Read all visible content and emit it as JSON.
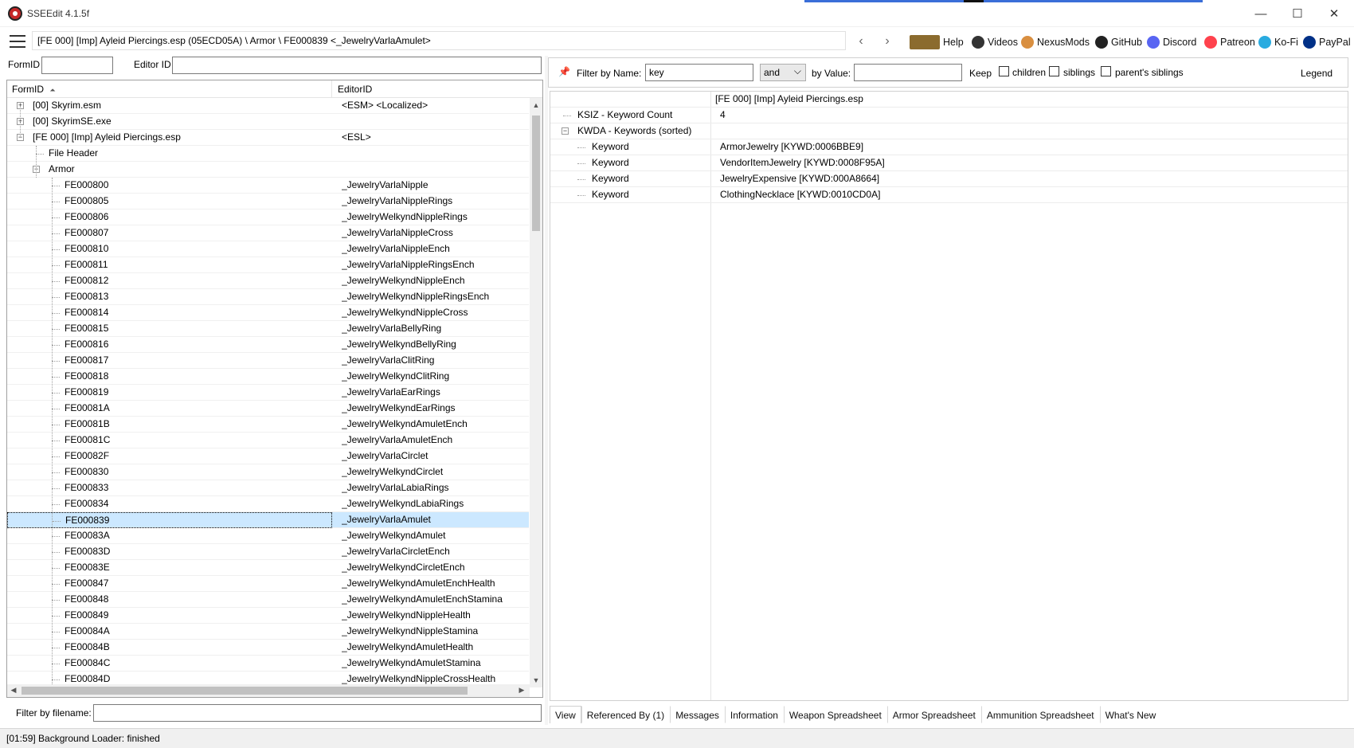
{
  "window": {
    "title": "SSEEdit 4.1.5f"
  },
  "toolbar": {
    "path": "[FE 000] [Imp] Ayleid Piercings.esp (05ECD05A) \\ Armor \\ FE000839 <_JewelryVarlaAmulet>",
    "back_glyph": "‹",
    "forward_glyph": "›",
    "links": [
      {
        "name": "help",
        "label": "Help",
        "icon": "book-icon",
        "color": "#8b6b2e"
      },
      {
        "name": "videos",
        "label": "Videos",
        "icon": "videos-icon",
        "color": "#333333"
      },
      {
        "name": "nexusmods",
        "label": "NexusMods",
        "icon": "nexusmods-icon",
        "color": "#d98f40"
      },
      {
        "name": "github",
        "label": "GitHub",
        "icon": "github-icon",
        "color": "#222222"
      },
      {
        "name": "discord",
        "label": "Discord",
        "icon": "discord-icon",
        "color": "#5865f2"
      },
      {
        "name": "patreon",
        "label": "Patreon",
        "icon": "patreon-icon",
        "color": "#ff424d"
      },
      {
        "name": "kofi",
        "label": "Ko-Fi",
        "icon": "kofi-icon",
        "color": "#29abe0"
      },
      {
        "name": "paypal",
        "label": "PayPal",
        "icon": "paypal-icon",
        "color": "#003087"
      }
    ]
  },
  "left": {
    "formid_label": "FormID",
    "editorid_label": "Editor ID",
    "formid_value": "",
    "editorid_value": "",
    "columns": {
      "formid": "FormID",
      "editorid": "EditorID"
    },
    "sort_glyph": "⏶",
    "filter_label": "Filter by filename:",
    "filter_value": "",
    "tree": [
      {
        "level": 0,
        "exp": "+",
        "formid": "[00] Skyrim.esm",
        "editorid": "<ESM> <Localized>"
      },
      {
        "level": 0,
        "exp": "+",
        "formid": "[00] SkyrimSE.exe",
        "editorid": ""
      },
      {
        "level": 0,
        "exp": "−",
        "formid": "[FE 000] [Imp] Ayleid Piercings.esp",
        "editorid": "<ESL>"
      },
      {
        "level": 1,
        "exp": "",
        "formid": "File Header",
        "editorid": ""
      },
      {
        "level": 1,
        "exp": "−",
        "formid": "Armor",
        "editorid": ""
      },
      {
        "level": 2,
        "exp": "",
        "formid": "FE000800",
        "editorid": "_JewelryVarlaNipple"
      },
      {
        "level": 2,
        "exp": "",
        "formid": "FE000805",
        "editorid": "_JewelryVarlaNippleRings"
      },
      {
        "level": 2,
        "exp": "",
        "formid": "FE000806",
        "editorid": "_JewelryWelkyndNippleRings"
      },
      {
        "level": 2,
        "exp": "",
        "formid": "FE000807",
        "editorid": "_JewelryVarlaNippleCross"
      },
      {
        "level": 2,
        "exp": "",
        "formid": "FE000810",
        "editorid": "_JewelryVarlaNippleEnch"
      },
      {
        "level": 2,
        "exp": "",
        "formid": "FE000811",
        "editorid": "_JewelryVarlaNippleRingsEnch"
      },
      {
        "level": 2,
        "exp": "",
        "formid": "FE000812",
        "editorid": "_JewelryWelkyndNippleEnch"
      },
      {
        "level": 2,
        "exp": "",
        "formid": "FE000813",
        "editorid": "_JewelryWelkyndNippleRingsEnch"
      },
      {
        "level": 2,
        "exp": "",
        "formid": "FE000814",
        "editorid": "_JewelryWelkyndNippleCross"
      },
      {
        "level": 2,
        "exp": "",
        "formid": "FE000815",
        "editorid": "_JewelryVarlaBellyRing"
      },
      {
        "level": 2,
        "exp": "",
        "formid": "FE000816",
        "editorid": "_JewelryWelkyndBellyRing"
      },
      {
        "level": 2,
        "exp": "",
        "formid": "FE000817",
        "editorid": "_JewelryVarlaClitRing"
      },
      {
        "level": 2,
        "exp": "",
        "formid": "FE000818",
        "editorid": "_JewelryWelkyndClitRing"
      },
      {
        "level": 2,
        "exp": "",
        "formid": "FE000819",
        "editorid": "_JewelryVarlaEarRings"
      },
      {
        "level": 2,
        "exp": "",
        "formid": "FE00081A",
        "editorid": "_JewelryWelkyndEarRings"
      },
      {
        "level": 2,
        "exp": "",
        "formid": "FE00081B",
        "editorid": "_JewelryWelkyndAmuletEnch"
      },
      {
        "level": 2,
        "exp": "",
        "formid": "FE00081C",
        "editorid": "_JewelryVarlaAmuletEnch"
      },
      {
        "level": 2,
        "exp": "",
        "formid": "FE00082F",
        "editorid": "_JewelryVarlaCirclet"
      },
      {
        "level": 2,
        "exp": "",
        "formid": "FE000830",
        "editorid": "_JewelryWelkyndCirclet"
      },
      {
        "level": 2,
        "exp": "",
        "formid": "FE000833",
        "editorid": "_JewelryVarlaLabiaRings"
      },
      {
        "level": 2,
        "exp": "",
        "formid": "FE000834",
        "editorid": "_JewelryWelkyndLabiaRings"
      },
      {
        "level": 2,
        "exp": "",
        "formid": "FE000839",
        "editorid": "_JewelryVarlaAmulet",
        "selected": true
      },
      {
        "level": 2,
        "exp": "",
        "formid": "FE00083A",
        "editorid": "_JewelryWelkyndAmulet"
      },
      {
        "level": 2,
        "exp": "",
        "formid": "FE00083D",
        "editorid": "_JewelryVarlaCircletEnch"
      },
      {
        "level": 2,
        "exp": "",
        "formid": "FE00083E",
        "editorid": "_JewelryWelkyndCircletEnch"
      },
      {
        "level": 2,
        "exp": "",
        "formid": "FE000847",
        "editorid": "_JewelryWelkyndAmuletEnchHealth"
      },
      {
        "level": 2,
        "exp": "",
        "formid": "FE000848",
        "editorid": "_JewelryWelkyndAmuletEnchStamina"
      },
      {
        "level": 2,
        "exp": "",
        "formid": "FE000849",
        "editorid": "_JewelryWelkyndNippleHealth"
      },
      {
        "level": 2,
        "exp": "",
        "formid": "FE00084A",
        "editorid": "_JewelryWelkyndNippleStamina"
      },
      {
        "level": 2,
        "exp": "",
        "formid": "FE00084B",
        "editorid": "_JewelryWelkyndAmuletHealth"
      },
      {
        "level": 2,
        "exp": "",
        "formid": "FE00084C",
        "editorid": "_JewelryWelkyndAmuletStamina"
      },
      {
        "level": 2,
        "exp": "",
        "formid": "FE00084D",
        "editorid": "_JewelryWelkyndNippleCrossHealth"
      }
    ]
  },
  "right": {
    "filter_name_label": "Filter by Name:",
    "filter_name_value": "key",
    "operator_value": "and",
    "by_value_label": "by Value:",
    "by_value_value": "",
    "keep_label": "Keep",
    "keep_options": [
      {
        "name": "children",
        "label": "children",
        "checked": false
      },
      {
        "name": "siblings",
        "label": "siblings",
        "checked": false
      },
      {
        "name": "parents-siblings",
        "label": "parent's siblings",
        "checked": false
      }
    ],
    "legend_label": "Legend",
    "record_header": "[FE 000] [Imp] Ayleid Piercings.esp",
    "records": [
      {
        "indent": 1,
        "exp": "",
        "name": "KSIZ - Keyword Count",
        "value": "4"
      },
      {
        "indent": 1,
        "exp": "−",
        "name": "KWDA - Keywords (sorted)",
        "value": ""
      },
      {
        "indent": 2,
        "exp": "",
        "name": "Keyword",
        "value": "ArmorJewelry [KYWD:0006BBE9]"
      },
      {
        "indent": 2,
        "exp": "",
        "name": "Keyword",
        "value": "VendorItemJewelry [KYWD:0008F95A]"
      },
      {
        "indent": 2,
        "exp": "",
        "name": "Keyword",
        "value": "JewelryExpensive [KYWD:000A8664]"
      },
      {
        "indent": 2,
        "exp": "",
        "name": "Keyword",
        "value": "ClothingNecklace [KYWD:0010CD0A]"
      }
    ],
    "tabs": [
      {
        "name": "view",
        "label": "View",
        "active": true
      },
      {
        "name": "referenced-by",
        "label": "Referenced By (1)"
      },
      {
        "name": "messages",
        "label": "Messages"
      },
      {
        "name": "information",
        "label": "Information"
      },
      {
        "name": "weapon-spreadsheet",
        "label": "Weapon Spreadsheet"
      },
      {
        "name": "armor-spreadsheet",
        "label": "Armor Spreadsheet"
      },
      {
        "name": "ammunition-spreadsheet",
        "label": "Ammunition Spreadsheet"
      },
      {
        "name": "whats-new",
        "label": "What's New"
      }
    ]
  },
  "status": {
    "text": "[01:59] Background Loader: finished"
  }
}
